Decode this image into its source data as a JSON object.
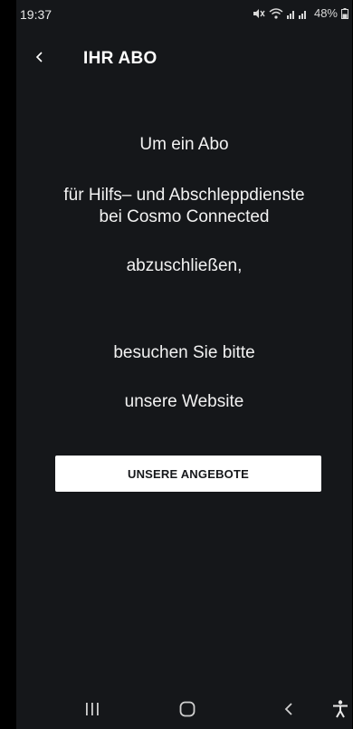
{
  "status_bar": {
    "time": "19:37",
    "battery": "48%"
  },
  "header": {
    "title": "IHR ABO"
  },
  "message": {
    "line1": "Um ein Abo",
    "line2a": "für Hilfs– und Abschleppdienste",
    "line2b": "bei Cosmo Connected",
    "line3": "abzuschließen,",
    "line4": "besuchen Sie bitte",
    "line5": "unsere Website"
  },
  "cta": {
    "label": "UNSERE ANGEBOTE"
  },
  "nav_bar": {
    "icons": [
      "recent-apps-icon",
      "home-icon",
      "back-icon",
      "accessibility-icon"
    ]
  },
  "colors": {
    "background": "#15171a",
    "text": "#ffffff",
    "button_bg": "#ffffff",
    "button_text": "#15171a"
  }
}
